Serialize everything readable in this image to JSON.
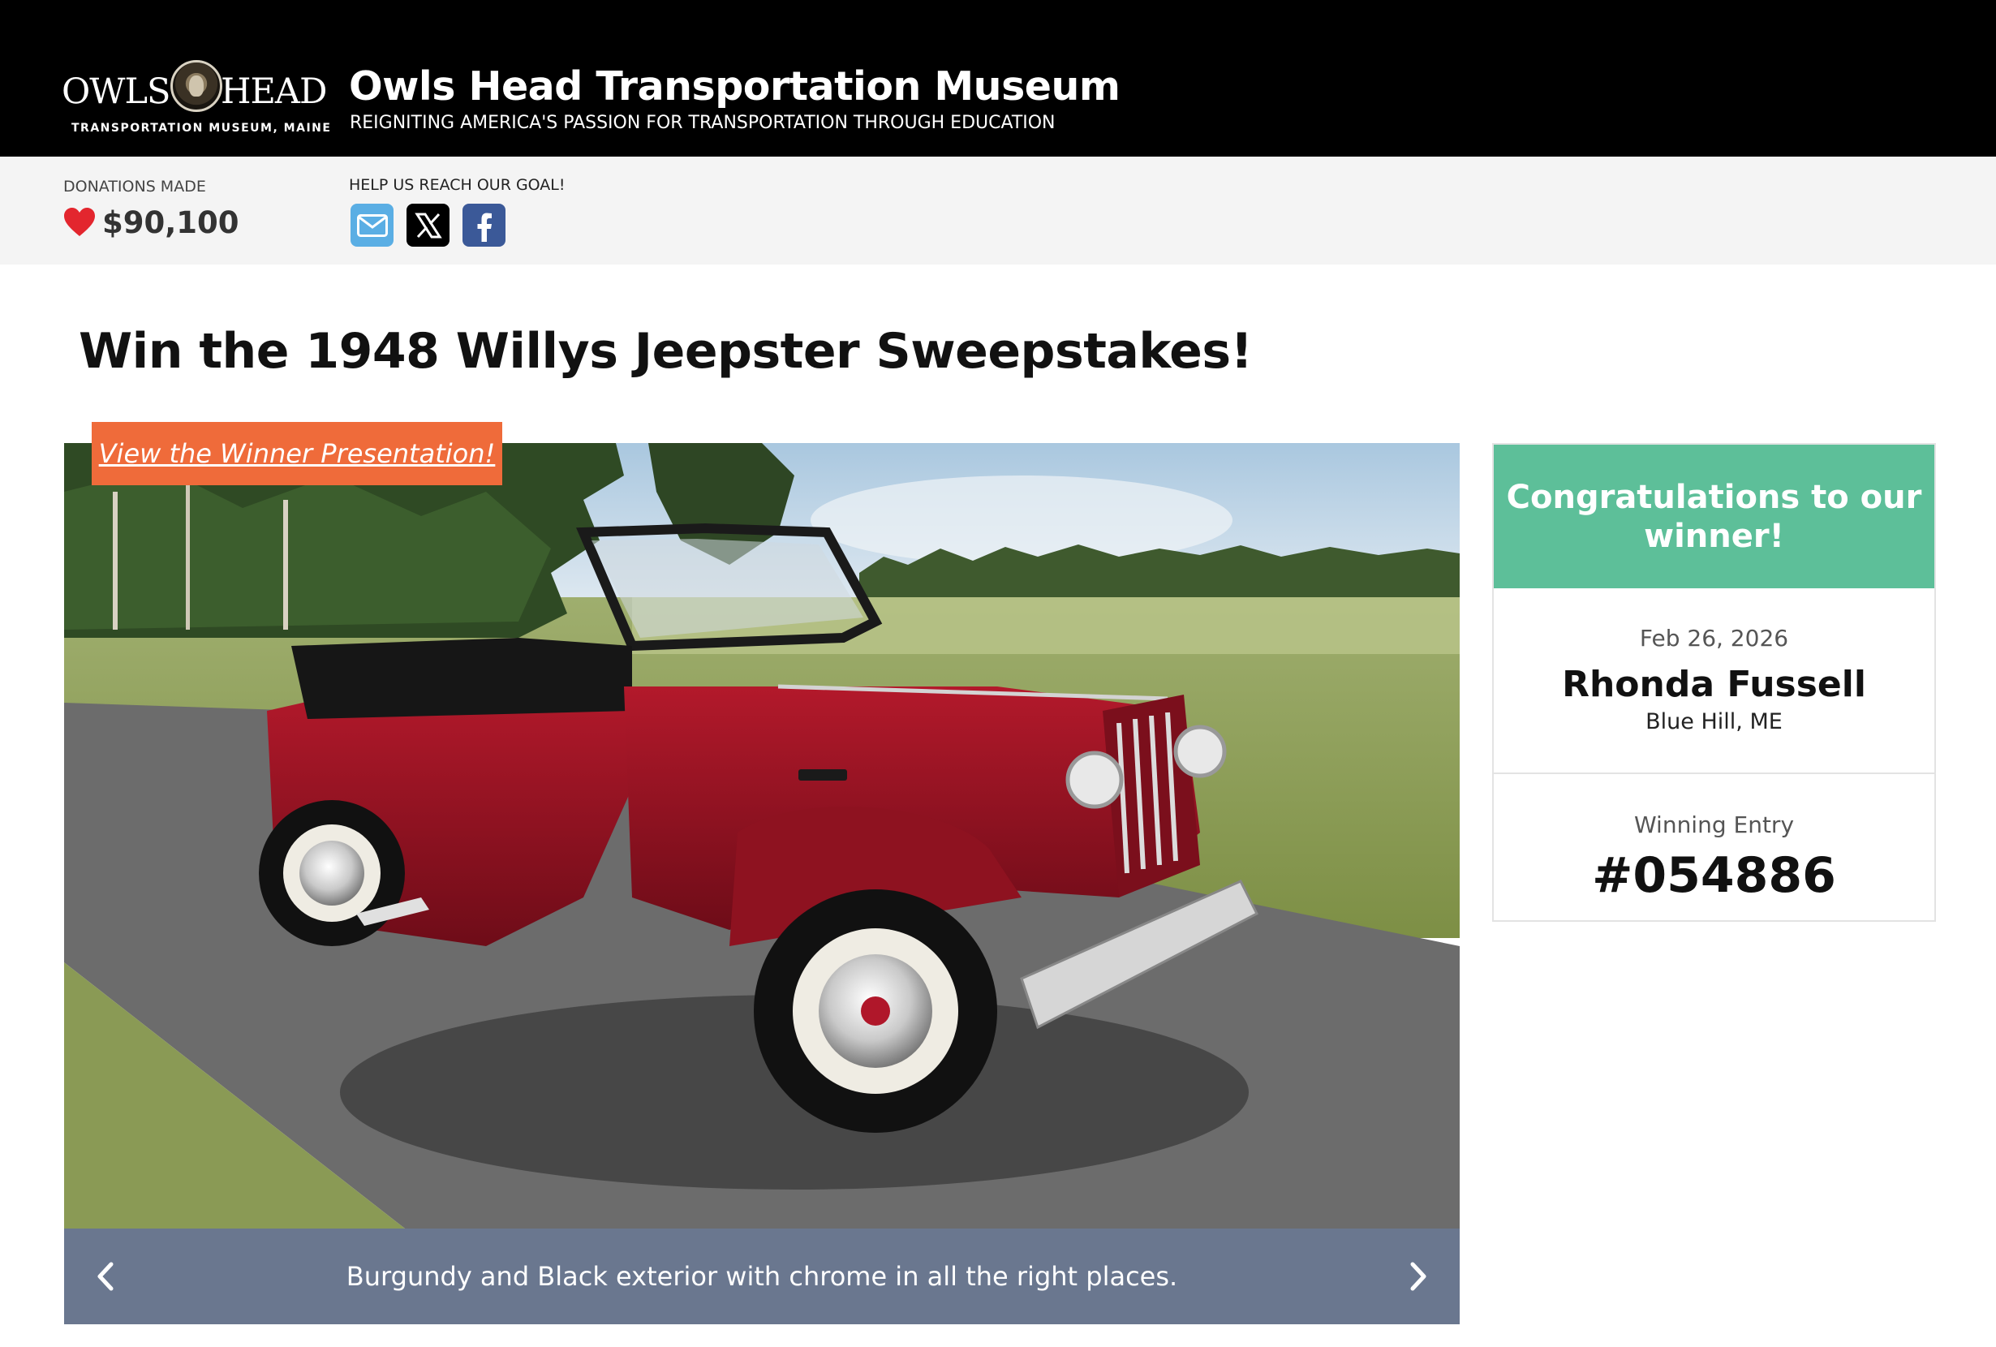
{
  "header": {
    "logo_word_1": "OWLS",
    "logo_word_2": "HEAD",
    "logo_subtitle": "TRANSPORTATION MUSEUM, MAINE",
    "site_title": "Owls Head Transportation Museum",
    "tagline": "REIGNITING AMERICA'S PASSION FOR TRANSPORTATION THROUGH EDUCATION"
  },
  "stats": {
    "donations_label": "DONATIONS MADE",
    "donations_amount": "$90,100",
    "share_label": "HELP US REACH OUR GOAL!",
    "share_icons": [
      "email-icon",
      "x-icon",
      "facebook-icon"
    ]
  },
  "page_title": "Win the 1948 Willys Jeepster Sweepstakes!",
  "gallery": {
    "winner_presentation_label": "View the Winner Presentation!",
    "caption": "Burgundy and Black exterior with chrome in all the right places."
  },
  "winner": {
    "heading": "Congratulations to our winner!",
    "date": "Feb 26, 2026",
    "name": "Rhonda Fussell",
    "location": "Blue Hill, ME",
    "entry_label": "Winning Entry",
    "entry_number": "#054886"
  },
  "colors": {
    "header_bg": "#000000",
    "stats_bg": "#f4f4f4",
    "accent_orange": "#ef6b3a",
    "winner_green": "#5dbf99",
    "caption_bg": "#6a778f",
    "heart_red": "#e3262e"
  }
}
